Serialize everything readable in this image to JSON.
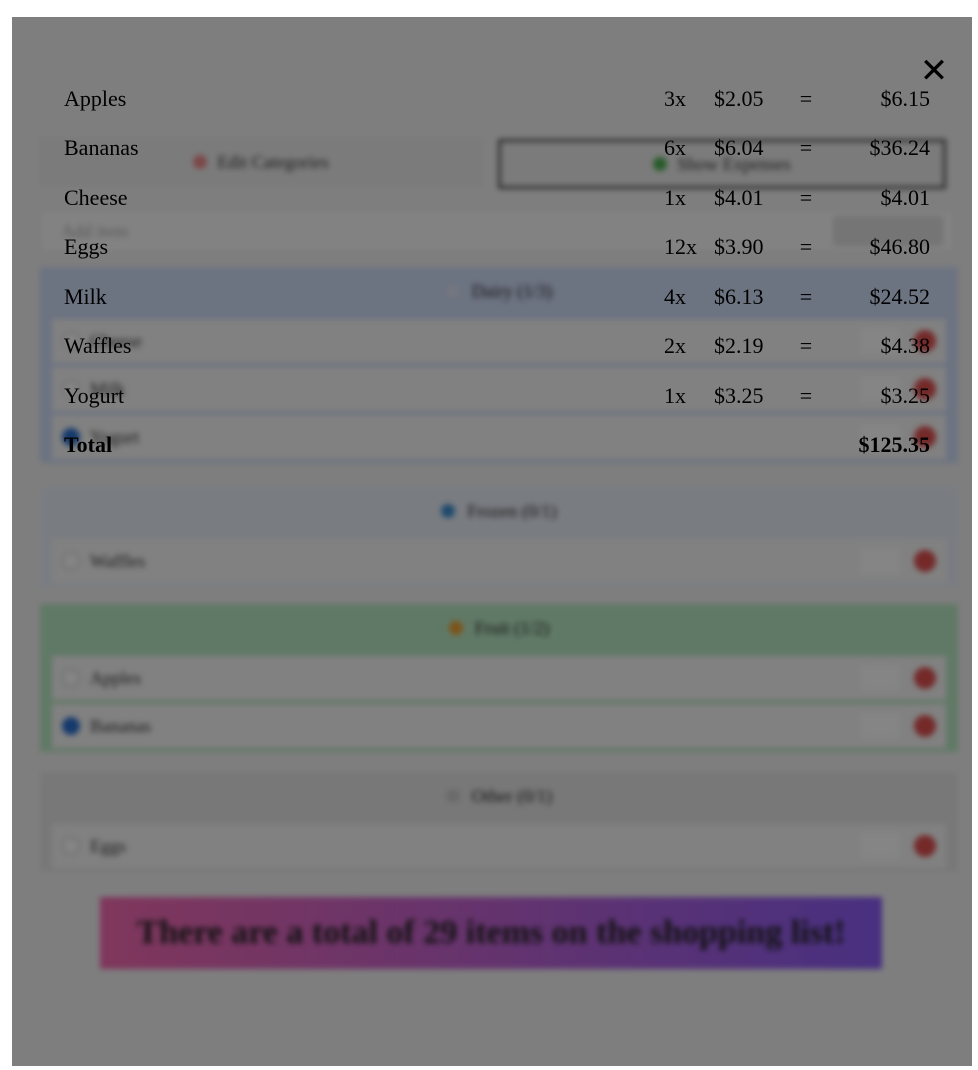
{
  "background": {
    "edit_categories_label": "Edit Categories",
    "show_expenses_label": "Show Expenses",
    "add_item_placeholder": "Add item",
    "categories": [
      {
        "title": "Dairy (1/3)",
        "color": "#cfdcf7",
        "icon": "milk-icon",
        "items": [
          {
            "name": "Cheese",
            "checked": false
          },
          {
            "name": "Milk",
            "checked": false
          },
          {
            "name": "Yogurt",
            "checked": true
          }
        ]
      },
      {
        "title": "Frozen (0/1)",
        "color": "#e9eef8",
        "icon": "snowflake-icon",
        "items": [
          {
            "name": "Waffles",
            "checked": false
          }
        ]
      },
      {
        "title": "Fruit (1/2)",
        "color": "#b9e8c4",
        "icon": "fruit-icon",
        "items": [
          {
            "name": "Apples",
            "checked": false
          },
          {
            "name": "Bananas",
            "checked": true
          }
        ]
      },
      {
        "title": "Other (0/1)",
        "color": "#e6e6e6",
        "icon": "box-icon",
        "items": [
          {
            "name": "Eggs",
            "checked": false
          }
        ]
      }
    ],
    "summary_banner": "There are a total of 29 items on the shopping list!"
  },
  "expenses_modal": {
    "close_icon": "close-icon",
    "close_glyph": "✕",
    "rows": [
      {
        "name": "Apples",
        "qty": "3x",
        "price": "$2.05",
        "eq": "=",
        "total": "$6.15"
      },
      {
        "name": "Bananas",
        "qty": "6x",
        "price": "$6.04",
        "eq": "=",
        "total": "$36.24"
      },
      {
        "name": "Cheese",
        "qty": "1x",
        "price": "$4.01",
        "eq": "=",
        "total": "$4.01"
      },
      {
        "name": "Eggs",
        "qty": "12x",
        "price": "$3.90",
        "eq": "=",
        "total": "$46.80"
      },
      {
        "name": "Milk",
        "qty": "4x",
        "price": "$6.13",
        "eq": "=",
        "total": "$24.52"
      },
      {
        "name": "Waffles",
        "qty": "2x",
        "price": "$2.19",
        "eq": "=",
        "total": "$4.38"
      },
      {
        "name": "Yogurt",
        "qty": "1x",
        "price": "$3.25",
        "eq": "=",
        "total": "$3.25"
      }
    ],
    "total_label": "Total",
    "total_value": "$125.35"
  }
}
